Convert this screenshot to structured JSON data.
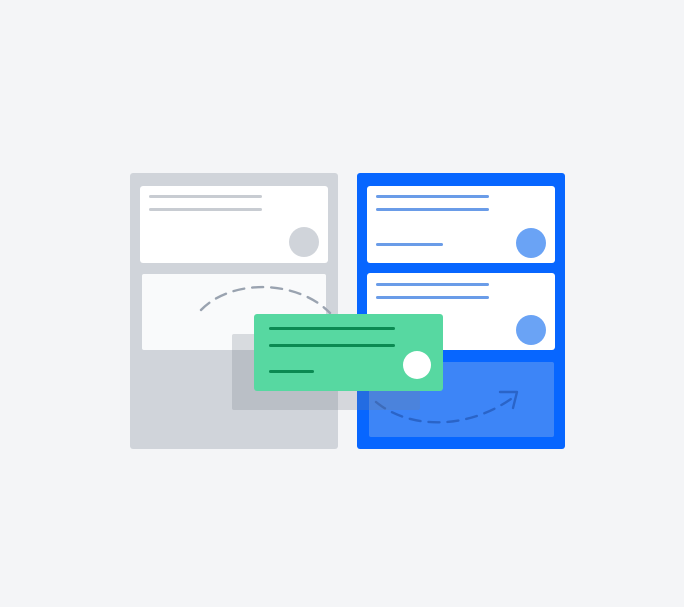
{
  "colors": {
    "background": "#f4f5f7",
    "source_column": "#d0d4da",
    "source_line": "#c8ccd2",
    "source_dot": "#d0d4da",
    "target_column": "#0766ff",
    "target_line": "#6a9ce8",
    "target_dot": "#6aa3f5",
    "drop_zone": "#3d85f7",
    "moving_card": "#57d8a1",
    "moving_line": "#0b8a52",
    "moving_dot": "#ffffff",
    "path_arrow": "#9aa3b0"
  },
  "illustration": {
    "subject": "card-moving-between-columns",
    "icons": [
      "curved-dashed-arrow-icon"
    ]
  }
}
